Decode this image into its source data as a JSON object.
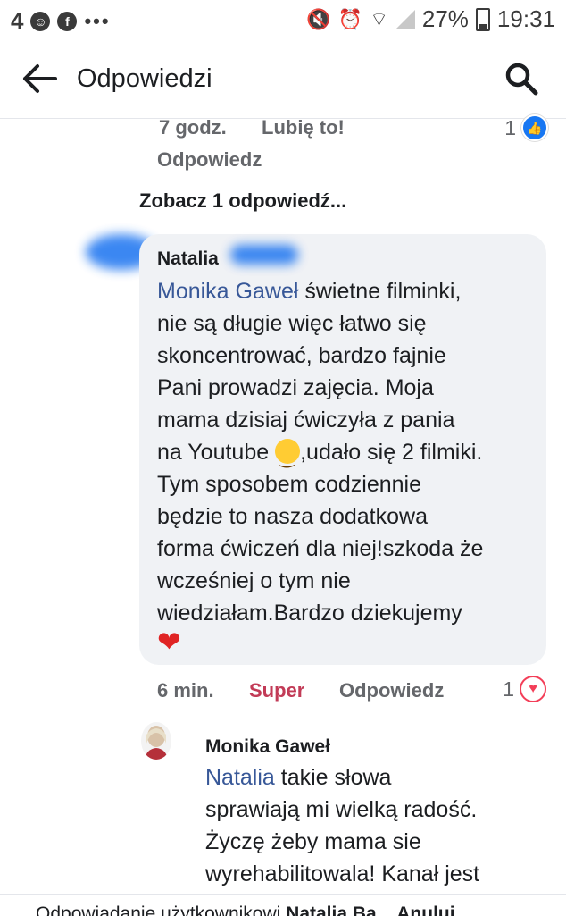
{
  "status_bar": {
    "left_number": "4",
    "battery": "27%",
    "time": "19:31"
  },
  "app_bar": {
    "title": "Odpowiedzi"
  },
  "prev_comment": {
    "time": "7 godz.",
    "like_label": "Lubię to!",
    "reply_label": "Odpowiedz",
    "like_count": "1"
  },
  "see_replies": "Zobacz 1 odpowiedź...",
  "comment1": {
    "author": "Natalia",
    "mention": "Monika Gaweł",
    "lines": [
      " świetne filminki,",
      "nie są długie więc łatwo się",
      "skoncentrować, bardzo fajnie",
      "Pani prowadzi zajęcia. Moja",
      "mama dzisiaj ćwiczyła z pania",
      "na Youtube ",
      ",udało się 2 filmiki.",
      "Tym sposobem codziennie",
      "będzie to nasza dodatkowa",
      "forma ćwiczeń dla niej!szkoda że",
      "wcześniej o tym nie",
      "wiedziałam.Bardzo dziekujemy"
    ],
    "heart_emoji": "❤",
    "time": "6 min.",
    "reaction_label": "Super",
    "reply_label": "Odpowiedz",
    "reaction_count": "1",
    "reaction_color": "#c23b57"
  },
  "comment2": {
    "author": "Monika Gaweł",
    "mention": "Natalia",
    "lines": [
      " takie słowa",
      "sprawiają mi wielką radość.",
      "Życzę żeby mama sie",
      "wyrehabilitowala!  Kanał jest"
    ]
  },
  "bottom_bar": {
    "prefix": "Odpowiadanie użytkownikowi ",
    "name": "Natalia Ba",
    "suffix": "... Anuluj"
  }
}
